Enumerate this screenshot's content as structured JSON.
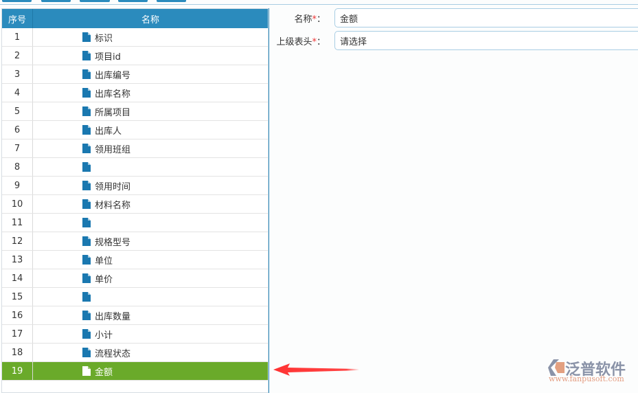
{
  "table": {
    "headers": {
      "index": "序号",
      "name": "名称"
    },
    "rows": [
      {
        "index": "1",
        "name": "标识"
      },
      {
        "index": "2",
        "name": "项目id"
      },
      {
        "index": "3",
        "name": "出库编号"
      },
      {
        "index": "4",
        "name": "出库名称"
      },
      {
        "index": "5",
        "name": "所属项目"
      },
      {
        "index": "6",
        "name": "出库人"
      },
      {
        "index": "7",
        "name": "领用班组"
      },
      {
        "index": "8",
        "name": ""
      },
      {
        "index": "9",
        "name": "领用时间"
      },
      {
        "index": "10",
        "name": "材料名称"
      },
      {
        "index": "11",
        "name": ""
      },
      {
        "index": "12",
        "name": "规格型号"
      },
      {
        "index": "13",
        "name": "单位"
      },
      {
        "index": "14",
        "name": "单价"
      },
      {
        "index": "15",
        "name": ""
      },
      {
        "index": "16",
        "name": "出库数量"
      },
      {
        "index": "17",
        "name": "小计"
      },
      {
        "index": "18",
        "name": "流程状态"
      },
      {
        "index": "19",
        "name": "金额",
        "selected": true
      }
    ]
  },
  "form": {
    "name_label": "名称",
    "name_value": "金额",
    "parent_label": "上级表头",
    "parent_value": "请选择",
    "required_mark": "*",
    "colon": "："
  },
  "logo": {
    "text": "泛普软件",
    "url": "www.fanpusoft.com"
  },
  "colors": {
    "header": "#2b8bbd",
    "selected": "#6aaa2a",
    "icon": "#1a78b0"
  }
}
